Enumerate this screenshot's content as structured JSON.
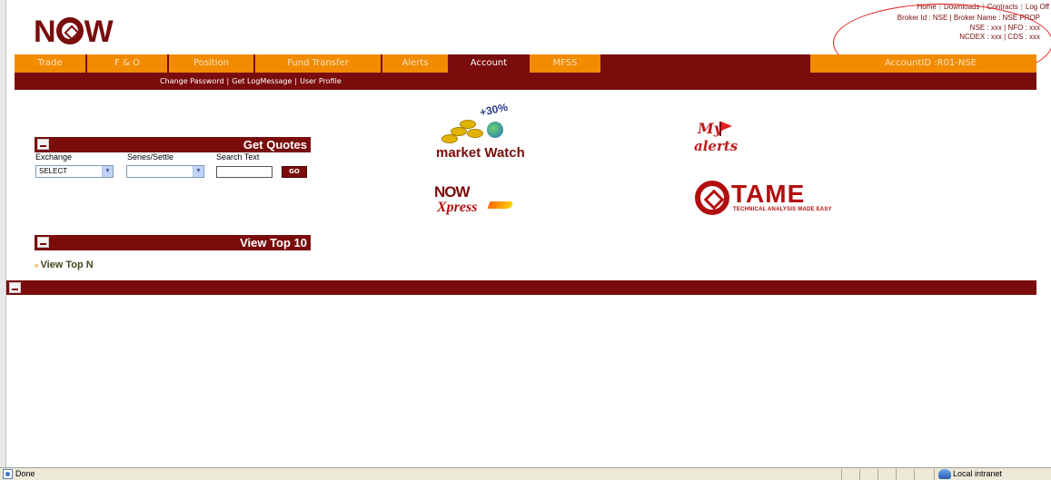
{
  "brand": {
    "logo_text_n": "N",
    "logo_text_w": "W"
  },
  "top_links": [
    "Home",
    "Downloads",
    "Contracts",
    "Log Off"
  ],
  "broker_info": {
    "line1": "Broker Id : NSE | Broker Name : NSE PROP",
    "line2": "NSE : xxx | NFO : xxx",
    "line3": "NCDEX : xxx | CDS : xxx"
  },
  "nav": {
    "tabs": [
      "Trade",
      "F & O",
      "Position",
      "Fund Transfer",
      "Alerts",
      "Account",
      "MFSS"
    ],
    "active": "Account",
    "account_id": "AccountID :R01-NSE"
  },
  "sub_nav": [
    "Change Password",
    "Get LogMessage",
    "User Profile"
  ],
  "get_quotes": {
    "title": "Get Quotes",
    "exchange_label": "Exchange",
    "series_label": "Series/Settle",
    "search_label": "Search Text",
    "exchange_value": "SELECT",
    "series_value": "",
    "search_value": "",
    "go_label": "GO"
  },
  "view_top": {
    "title": "View Top 10",
    "link": "View Top N"
  },
  "apps": {
    "market_watch_pct": "+30%",
    "market_watch_label": "market Watch",
    "xpress_now": "NOW",
    "xpress_label": "Xpress",
    "alerts_my": "My",
    "alerts_label": "alerts",
    "tame_word": "TAME",
    "tame_tagline": "TECHNICAL ANALYSIS MADE EASY"
  },
  "status_bar": {
    "status": "Done",
    "zone": "Local intranet"
  },
  "colors": {
    "maroon": "#7a0c0c",
    "orange": "#f28b00",
    "annotation_red": "#e51c1c"
  }
}
